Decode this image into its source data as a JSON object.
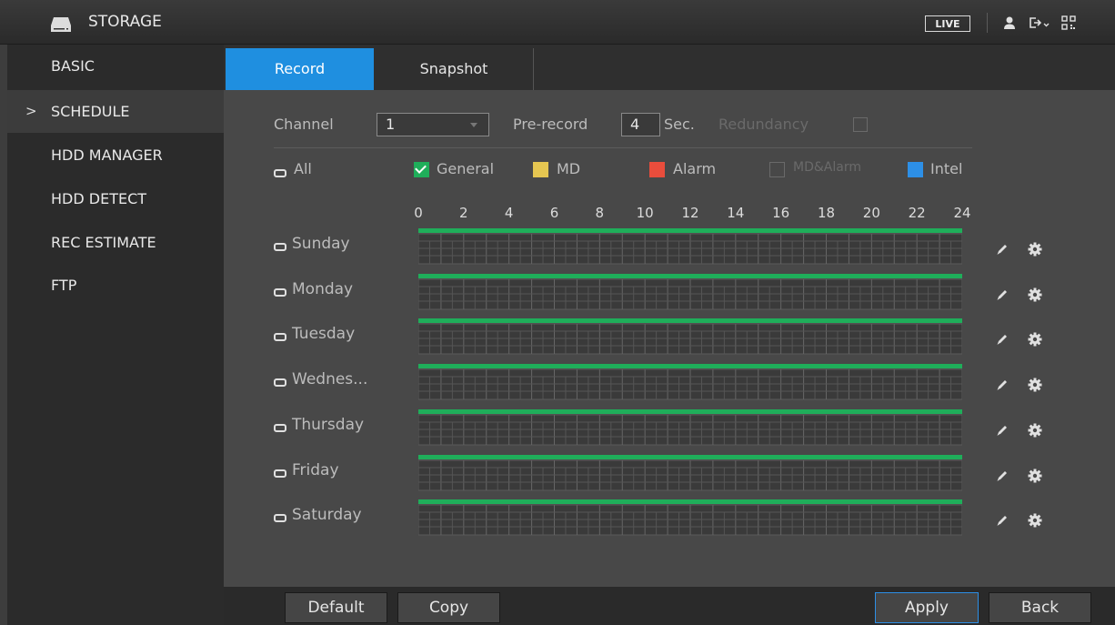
{
  "header": {
    "title": "STORAGE",
    "live_label": "LIVE"
  },
  "sidebar": {
    "items": [
      {
        "label": "BASIC"
      },
      {
        "label": "SCHEDULE",
        "active": true
      },
      {
        "label": "HDD MANAGER"
      },
      {
        "label": "HDD DETECT"
      },
      {
        "label": "REC ESTIMATE"
      },
      {
        "label": "FTP"
      }
    ],
    "active_marker": ">"
  },
  "tabs": [
    {
      "label": "Record",
      "active": true
    },
    {
      "label": "Snapshot"
    }
  ],
  "form": {
    "channel_label": "Channel",
    "channel_value": "1",
    "prerecord_label": "Pre-record",
    "prerecord_value": "4",
    "prerecord_unit": "Sec.",
    "redundancy_label": "Redundancy"
  },
  "legend": {
    "all_label": "All",
    "general": "General",
    "md": "MD",
    "alarm": "Alarm",
    "mdalarm": "MD&Alarm",
    "intel": "Intel"
  },
  "hours": [
    "0",
    "2",
    "4",
    "6",
    "8",
    "10",
    "12",
    "14",
    "16",
    "18",
    "20",
    "22",
    "24"
  ],
  "days": [
    {
      "label": "Sunday",
      "general": [
        0,
        24
      ]
    },
    {
      "label": "Monday",
      "general": [
        0,
        24
      ]
    },
    {
      "label": "Tuesday",
      "general": [
        0,
        24
      ]
    },
    {
      "label": "Wednes...",
      "general": [
        0,
        24
      ]
    },
    {
      "label": "Thursday",
      "general": [
        0,
        24
      ]
    },
    {
      "label": "Friday",
      "general": [
        0,
        24
      ]
    },
    {
      "label": "Saturday",
      "general": [
        0,
        24
      ]
    }
  ],
  "colors": {
    "general": "#1fae5a",
    "md": "#e5c651",
    "alarm": "#e94d3c",
    "intel": "#2d8fe6",
    "accent": "#1f8fe0"
  },
  "buttons": {
    "default": "Default",
    "copy": "Copy",
    "apply": "Apply",
    "back": "Back"
  }
}
